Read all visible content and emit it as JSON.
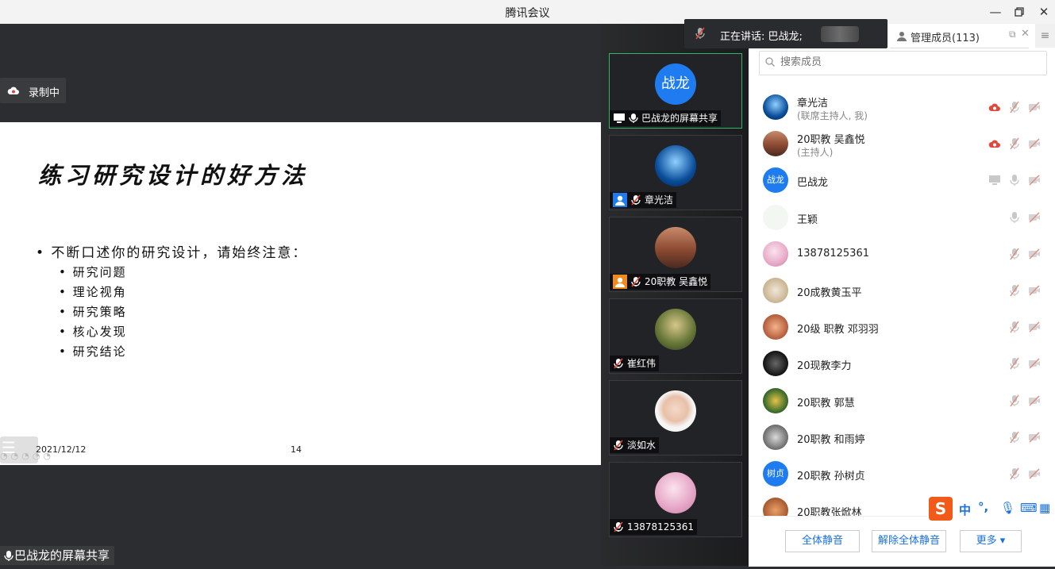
{
  "window": {
    "title": "腾讯会议"
  },
  "recording": {
    "label": "录制中"
  },
  "slide": {
    "title": "练习研究设计的好方法",
    "bullet": "• 不断口述你的研究设计，请始终注意：",
    "sub_items": [
      "• 研究问题",
      "• 理论视角",
      "• 研究策略",
      "• 核心发现",
      "• 研究结论"
    ],
    "date": "2021/12/12",
    "page": "14"
  },
  "share_label": "巴战龙的屏幕共享",
  "speaking": {
    "label": "正在讲话: 巴战龙;"
  },
  "videos": [
    {
      "name": "巴战龙的屏幕共享",
      "avatar_text": "战龙"
    },
    {
      "name": "章光洁"
    },
    {
      "name": "20职教 吴鑫悦"
    },
    {
      "name": "崔红伟"
    },
    {
      "name": "淡如水"
    },
    {
      "name": "13878125361"
    }
  ],
  "panel": {
    "tab_label": "管理成员(113)",
    "search_placeholder": "搜索成员",
    "members": [
      {
        "name": "章光洁",
        "role": "(联席主持人, 我)"
      },
      {
        "name": "20职教 吴鑫悦",
        "role": "(主持人)"
      },
      {
        "name": "巴战龙",
        "avatar_text": "战龙"
      },
      {
        "name": "王颖"
      },
      {
        "name": "13878125361"
      },
      {
        "name": "20成教黄玉平"
      },
      {
        "name": "20级 职教 邓羽羽"
      },
      {
        "name": "20现教李力"
      },
      {
        "name": "20职教 郭慧"
      },
      {
        "name": "20职教 和雨婷"
      },
      {
        "name": "20职教 孙树贞",
        "avatar_text": "树贞"
      },
      {
        "name": "20职教张焮林"
      }
    ],
    "buttons": {
      "mute_all": "全体静音",
      "unmute_all": "解除全体静音",
      "more": "更多 ▾"
    }
  },
  "ime": {
    "label": "中"
  },
  "colors": {
    "accent": "#1f7cf0",
    "active_border": "#35b36b",
    "mute_red": "#e0483b"
  }
}
